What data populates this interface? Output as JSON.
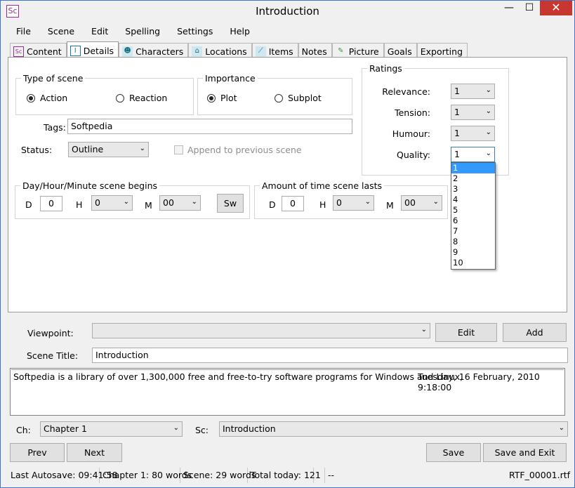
{
  "window": {
    "title": "Introduction",
    "app_icon": "Sc"
  },
  "menu": [
    "File",
    "Scene",
    "Edit",
    "Spelling",
    "Settings",
    "Help"
  ],
  "tabs": [
    {
      "label": "Content",
      "icon": "Sc",
      "active": false
    },
    {
      "label": "Details",
      "icon": "I",
      "active": true
    },
    {
      "label": "Characters",
      "icon": "☻",
      "active": false
    },
    {
      "label": "Locations",
      "icon": "⌂",
      "active": false
    },
    {
      "label": "Items",
      "icon": "⟋",
      "active": false
    },
    {
      "label": "Notes",
      "icon": "",
      "active": false
    },
    {
      "label": "Picture",
      "icon": "✎",
      "active": false
    },
    {
      "label": "Goals",
      "icon": "",
      "active": false
    },
    {
      "label": "Exporting",
      "icon": "",
      "active": false
    }
  ],
  "scene_type": {
    "legend": "Type of scene",
    "action": "Action",
    "reaction": "Reaction",
    "selected": "action"
  },
  "importance": {
    "legend": "Importance",
    "plot": "Plot",
    "subplot": "Subplot",
    "selected": "plot"
  },
  "tags": {
    "label": "Tags:",
    "value": "Softpedia"
  },
  "status": {
    "label": "Status:",
    "value": "Outline",
    "append_label": "Append to previous scene"
  },
  "ratings": {
    "legend": "Ratings",
    "relevance_label": "Relevance:",
    "relevance": "1",
    "tension_label": "Tension:",
    "tension": "1",
    "humour_label": "Humour:",
    "humour": "1",
    "quality_label": "Quality:",
    "quality": "1",
    "quality_options": [
      "1",
      "2",
      "3",
      "4",
      "5",
      "6",
      "7",
      "8",
      "9",
      "10"
    ]
  },
  "begins": {
    "legend": "Day/Hour/Minute scene begins",
    "d_label": "D",
    "d": "0",
    "h_label": "H",
    "h": "0",
    "m_label": "M",
    "m": "00",
    "sw": "Sw"
  },
  "lasts": {
    "legend": "Amount of time scene lasts",
    "d_label": "D",
    "d": "0",
    "h_label": "H",
    "h": "0",
    "m_label": "M",
    "m": "00"
  },
  "viewpoint": {
    "label": "Viewpoint:",
    "value": "",
    "edit": "Edit",
    "add": "Add"
  },
  "scene_title": {
    "label": "Scene Title:",
    "value": "Introduction"
  },
  "memo": {
    "text": "Softpedia is a library of over 1,300,000 free and free-to-try software programs for Windows and Linux,",
    "stamp": "Tuesday, 16 February, 2010 9:18:00"
  },
  "chapter": {
    "label": "Ch:",
    "value": "Chapter 1"
  },
  "scene": {
    "label": "Sc:",
    "value": "Introduction"
  },
  "buttons": {
    "prev": "Prev",
    "next": "Next",
    "save": "Save",
    "save_exit": "Save and Exit"
  },
  "status_bar": {
    "autosave": "Last Autosave: 09:41:58",
    "chapter_words": "Chapter 1: 80 words",
    "scene_words": "Scene: 29 words",
    "total": "Total today: 121",
    "dash": "--",
    "file": "RTF_00001.rtf"
  }
}
